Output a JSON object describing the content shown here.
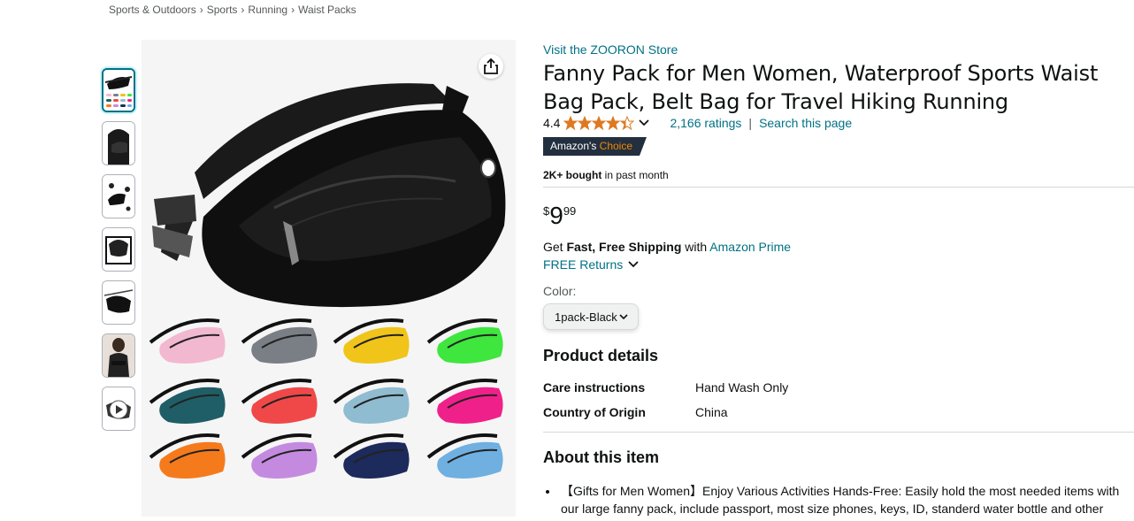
{
  "breadcrumb": [
    "Sports & Outdoors",
    "Sports",
    "Running",
    "Waist Packs"
  ],
  "breadcrumb_sep": "›",
  "product": {
    "store_link": "Visit the ZOORON Store",
    "title": "Fanny Pack for Men Women, Waterproof Sports Waist Bag Pack, Belt Bag for Travel Hiking Running",
    "rating": "4.4",
    "rating_stars": 4.4,
    "ratings_count": "2,166 ratings",
    "search_page": "Search this page",
    "badge_prefix": "Amazon's",
    "badge_choice": "Choice",
    "bought_bold": "2K+ bought",
    "bought_rest": " in past month",
    "price_symbol": "$",
    "price_whole": "9",
    "price_fraction": "99",
    "shipping_get": "Get ",
    "shipping_bold": "Fast, Free Shipping",
    "shipping_with": " with ",
    "shipping_link": "Amazon Prime",
    "returns": "FREE Returns",
    "color_label": "Color:",
    "color_value": "1pack-Black"
  },
  "details": {
    "heading": "Product details",
    "rows": [
      {
        "key": "Care instructions",
        "value": "Hand Wash Only"
      },
      {
        "key": "Country of Origin",
        "value": "China"
      }
    ]
  },
  "about": {
    "heading": "About this item",
    "bullet1": "【Gifts for Men Women】Enjoy Various Activities Hands-Free: Easily hold the most needed items with our large fanny pack, include passport, most size phones, keys, ID, standerd water bottle and other"
  },
  "swatch_colors": [
    "#f2b8d0",
    "#7a7f86",
    "#f0c419",
    "#3ee63e",
    "#1f5e66",
    "#f04848",
    "#8fbcd0",
    "#f0208a",
    "#f57a1c",
    "#c48ae0",
    "#1c2a5c",
    "#6fb0e0"
  ],
  "colors": {
    "link": "#007185",
    "star": "#de7921",
    "badge_bg": "#232f3e",
    "badge_choice": "#f08804"
  },
  "icons": [
    "share-icon",
    "chevron-down-icon",
    "play-icon"
  ]
}
